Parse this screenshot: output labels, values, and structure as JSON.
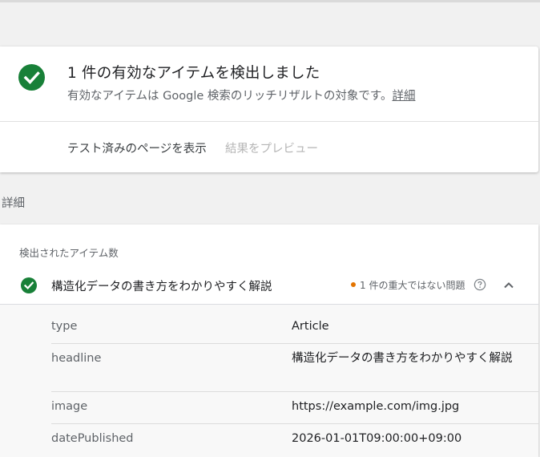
{
  "summary": {
    "title": "1 件の有効なアイテムを検出しました",
    "subtitle": "有効なアイテムは Google 検索のリッチリザルトの対象です。",
    "details_link": "詳細",
    "view_tested_page": "テスト済みのページを表示",
    "preview_results": "結果をプレビュー"
  },
  "details": {
    "section_title": "詳細",
    "detected_items_label": "検出されたアイテム数",
    "item": {
      "name": "構造化データの書き方をわかりやすく解説",
      "issue_text": "1 件の重大ではない問題"
    },
    "properties": [
      {
        "key": "type",
        "value": "Article"
      },
      {
        "key": "headline",
        "value": "構造化データの書き方をわかりやすく解説"
      },
      {
        "key": "image",
        "value": "https://example.com/img.jpg"
      },
      {
        "key": "datePublished",
        "value": "2026-01-01T09:00:00+09:00"
      }
    ]
  },
  "colors": {
    "valid_green": "#188038",
    "warning_orange": "#e37400"
  }
}
